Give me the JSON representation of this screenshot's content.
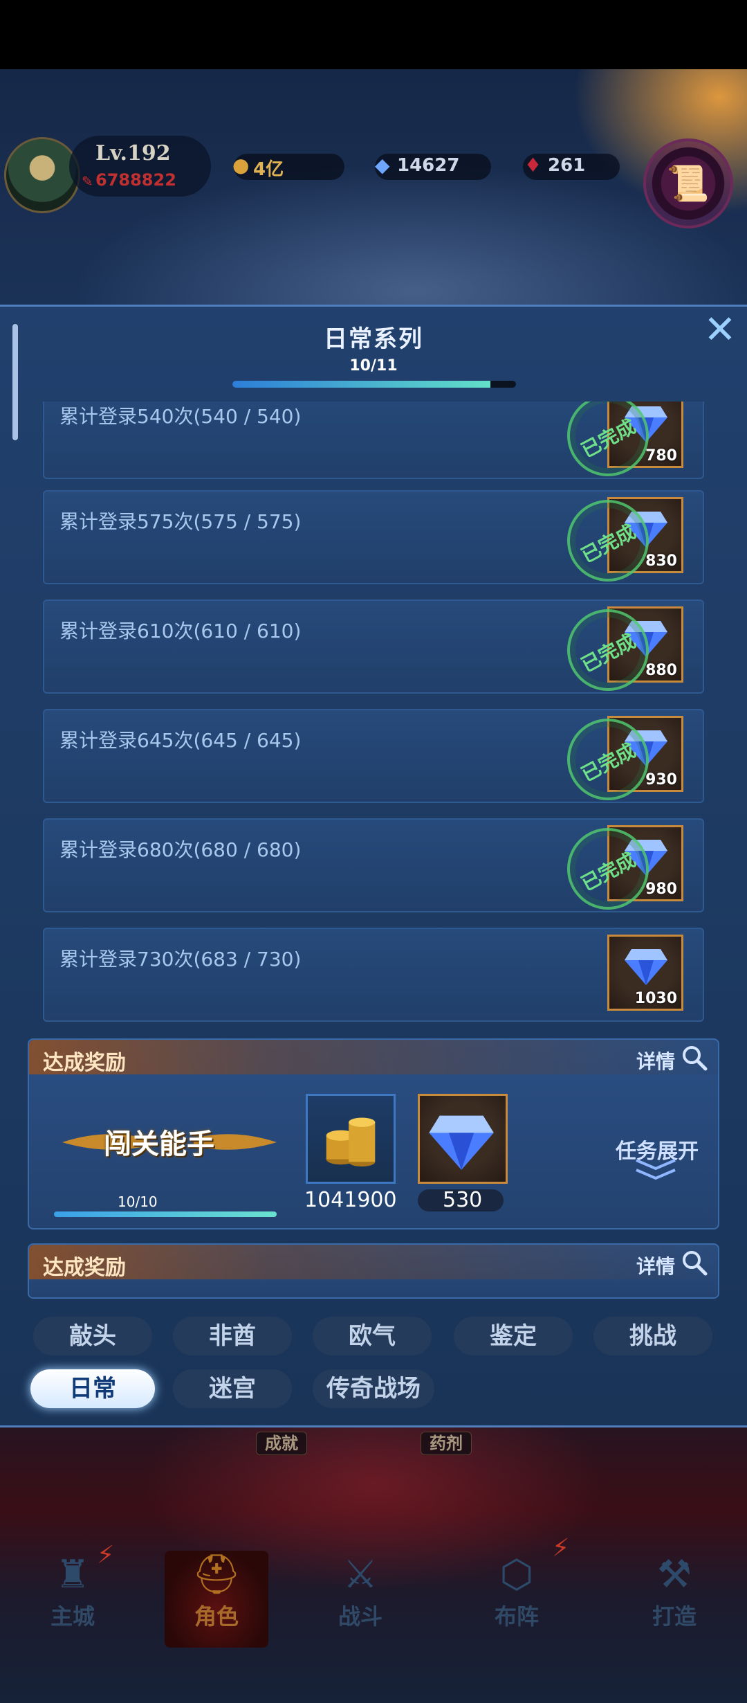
{
  "header": {
    "level": "Lv.192",
    "power": "6788822",
    "resources": [
      {
        "icon": "gold-coin-icon",
        "value": "4亿"
      },
      {
        "icon": "diamond-icon",
        "value": "14627"
      },
      {
        "icon": "ruby-icon",
        "value": "261"
      }
    ],
    "scroll_icon": "scroll-icon"
  },
  "dialog": {
    "title": "日常系列",
    "close_icon": "close-icon",
    "progress_label": "10/11",
    "progress_fraction": 0.9091,
    "tasks": [
      {
        "text": "累计登录540次(540 / 540)",
        "reward": "780",
        "completed": true,
        "stamp": "已完成"
      },
      {
        "text": "累计登录575次(575 / 575)",
        "reward": "830",
        "completed": true,
        "stamp": "已完成"
      },
      {
        "text": "累计登录610次(610 / 610)",
        "reward": "880",
        "completed": true,
        "stamp": "已完成"
      },
      {
        "text": "累计登录645次(645 / 645)",
        "reward": "930",
        "completed": true,
        "stamp": "已完成"
      },
      {
        "text": "累计登录680次(680 / 680)",
        "reward": "980",
        "completed": true,
        "stamp": "已完成"
      },
      {
        "text": "累计登录730次(683 / 730)",
        "reward": "1030",
        "completed": false,
        "stamp": ""
      }
    ]
  },
  "achievement": {
    "title": "达成奖励",
    "detail_label": "详情",
    "badge_title": "闯关能手",
    "progress_label": "10/10",
    "progress_fraction": 1.0,
    "rewards": [
      {
        "icon": "gold-coins-icon",
        "value": "1041900"
      },
      {
        "icon": "diamond-icon",
        "value": "530"
      }
    ],
    "expand_label": "任务展开"
  },
  "achievement2": {
    "title": "达成奖励",
    "detail_label": "详情"
  },
  "tabs": {
    "row1": [
      "敲头",
      "非酋",
      "欧气",
      "鉴定",
      "挑战"
    ],
    "row2": [
      "日常",
      "迷宫",
      "传奇战场"
    ],
    "active": "日常"
  },
  "bottom": {
    "mini_labels": [
      "成就",
      "药剂"
    ],
    "nav": [
      {
        "icon": "castle-icon",
        "label": "主城"
      },
      {
        "icon": "helmet-icon",
        "label": "角色"
      },
      {
        "icon": "crossed-swords-icon",
        "label": "战斗"
      },
      {
        "icon": "formation-icon",
        "label": "布阵"
      },
      {
        "icon": "anvil-icon",
        "label": "打造"
      }
    ],
    "active_nav": "角色"
  }
}
